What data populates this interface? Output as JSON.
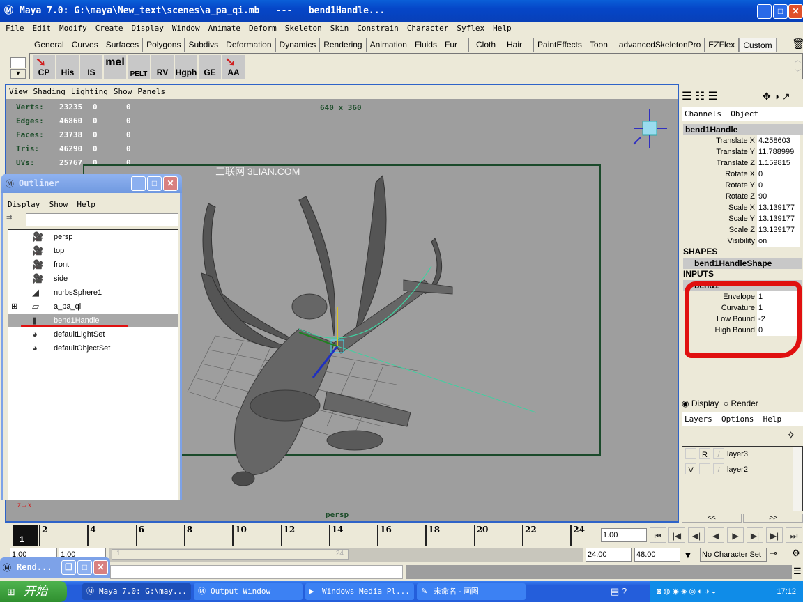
{
  "window": {
    "title": "Maya 7.0: G:\\maya\\New_text\\scenes\\a_pa_qi.mb   ---   bend1Handle...",
    "icon": "maya-icon"
  },
  "menu": [
    "File",
    "Edit",
    "Modify",
    "Create",
    "Display",
    "Window",
    "Animate",
    "Deform",
    "Skeleton",
    "Skin",
    "Constrain",
    "Character",
    "Syflex",
    "Help"
  ],
  "shelf_tabs": [
    "General",
    "Curves",
    "Surfaces",
    "Polygons",
    "Subdivs",
    "Deformation",
    "Dynamics",
    "Rendering",
    "Animation",
    "Fluids",
    "Fur",
    "Cloth",
    "Hair",
    "PaintEffects",
    "Toon",
    "advancedSkeletonPro",
    "EZFlex",
    "Custom"
  ],
  "active_shelf_tab": "Custom",
  "shelf_buttons": [
    "CP",
    "His",
    "IS",
    "mel",
    "PELT",
    "RV",
    "Hgph",
    "GE",
    "AA"
  ],
  "viewport": {
    "menu": [
      "View",
      "Shading",
      "Lighting",
      "Show",
      "Panels"
    ],
    "resolution": "640 x 360",
    "camera": "persp",
    "watermark": "三联网 3LIAN.COM",
    "stats": [
      {
        "label": "Verts:",
        "total": "23235",
        "sel": "0",
        "comp": "0"
      },
      {
        "label": "Edges:",
        "total": "46860",
        "sel": "0",
        "comp": "0"
      },
      {
        "label": "Faces:",
        "total": "23738",
        "sel": "0",
        "comp": "0"
      },
      {
        "label": "Tris:",
        "total": "46290",
        "sel": "0",
        "comp": "0"
      },
      {
        "label": "UVs:",
        "total": "25767",
        "sel": "0",
        "comp": "0"
      }
    ]
  },
  "outliner": {
    "title": "Outliner",
    "menu": [
      "Display",
      "Show",
      "Help"
    ],
    "items": [
      {
        "label": "persp",
        "icon": "camera-icon"
      },
      {
        "label": "top",
        "icon": "camera-icon"
      },
      {
        "label": "front",
        "icon": "camera-icon"
      },
      {
        "label": "side",
        "icon": "camera-icon"
      },
      {
        "label": "nurbsSphere1",
        "icon": "nurbs-surface-icon"
      },
      {
        "label": "a_pa_qi",
        "icon": "transform-icon",
        "expandable": true
      },
      {
        "label": "bend1Handle",
        "icon": "deformer-handle-icon",
        "selected": true
      },
      {
        "label": "defaultLightSet",
        "icon": "set-icon"
      },
      {
        "label": "defaultObjectSet",
        "icon": "set-icon"
      }
    ]
  },
  "channel_box": {
    "menu": [
      "Channels",
      "Object"
    ],
    "object": "bend1Handle",
    "channels": [
      {
        "name": "Translate X",
        "value": "4.258603"
      },
      {
        "name": "Translate Y",
        "value": "11.788999"
      },
      {
        "name": "Translate Z",
        "value": "1.159815"
      },
      {
        "name": "Rotate X",
        "value": "0"
      },
      {
        "name": "Rotate Y",
        "value": "0"
      },
      {
        "name": "Rotate Z",
        "value": "90"
      },
      {
        "name": "Scale X",
        "value": "13.139177"
      },
      {
        "name": "Scale Y",
        "value": "13.139177"
      },
      {
        "name": "Scale Z",
        "value": "13.139177"
      },
      {
        "name": "Visibility",
        "value": "on"
      }
    ],
    "shapes_header": "SHAPES",
    "shape": "bend1HandleShape",
    "inputs_header": "INPUTS",
    "input": "bend1",
    "input_channels": [
      {
        "name": "Envelope",
        "value": "1"
      },
      {
        "name": "Curvature",
        "value": "1"
      },
      {
        "name": "Low Bound",
        "value": "-2"
      },
      {
        "name": "High Bound",
        "value": "0"
      }
    ],
    "annotation_color": "#e01010"
  },
  "layers": {
    "modes": [
      "Display",
      "Render"
    ],
    "selected_mode": "Display",
    "menu": [
      "Layers",
      "Options",
      "Help"
    ],
    "items": [
      {
        "flag1": "",
        "flag2": "R",
        "name": "layer3"
      },
      {
        "flag1": "V",
        "flag2": "",
        "name": "layer2"
      }
    ],
    "prev": "<<",
    "next": ">>"
  },
  "timeline": {
    "ticks": [
      "2",
      "4",
      "6",
      "8",
      "10",
      "12",
      "14",
      "16",
      "18",
      "20",
      "22",
      "24"
    ],
    "current_frame": "1",
    "current_time": "1.00",
    "start": "1.00",
    "range_start": "1.00",
    "range_slider_start": "1",
    "range_slider_end": "24",
    "range_end": "24.00",
    "end": "48.00",
    "character_set": "No Character Set"
  },
  "minimized_window": "Rend...",
  "taskbar": {
    "start": "开始",
    "tasks": [
      "Maya 7.0: G:\\may...",
      "Output Window",
      "Windows Media Pl...",
      "未命名 - 画图"
    ],
    "clock": "17:12"
  }
}
